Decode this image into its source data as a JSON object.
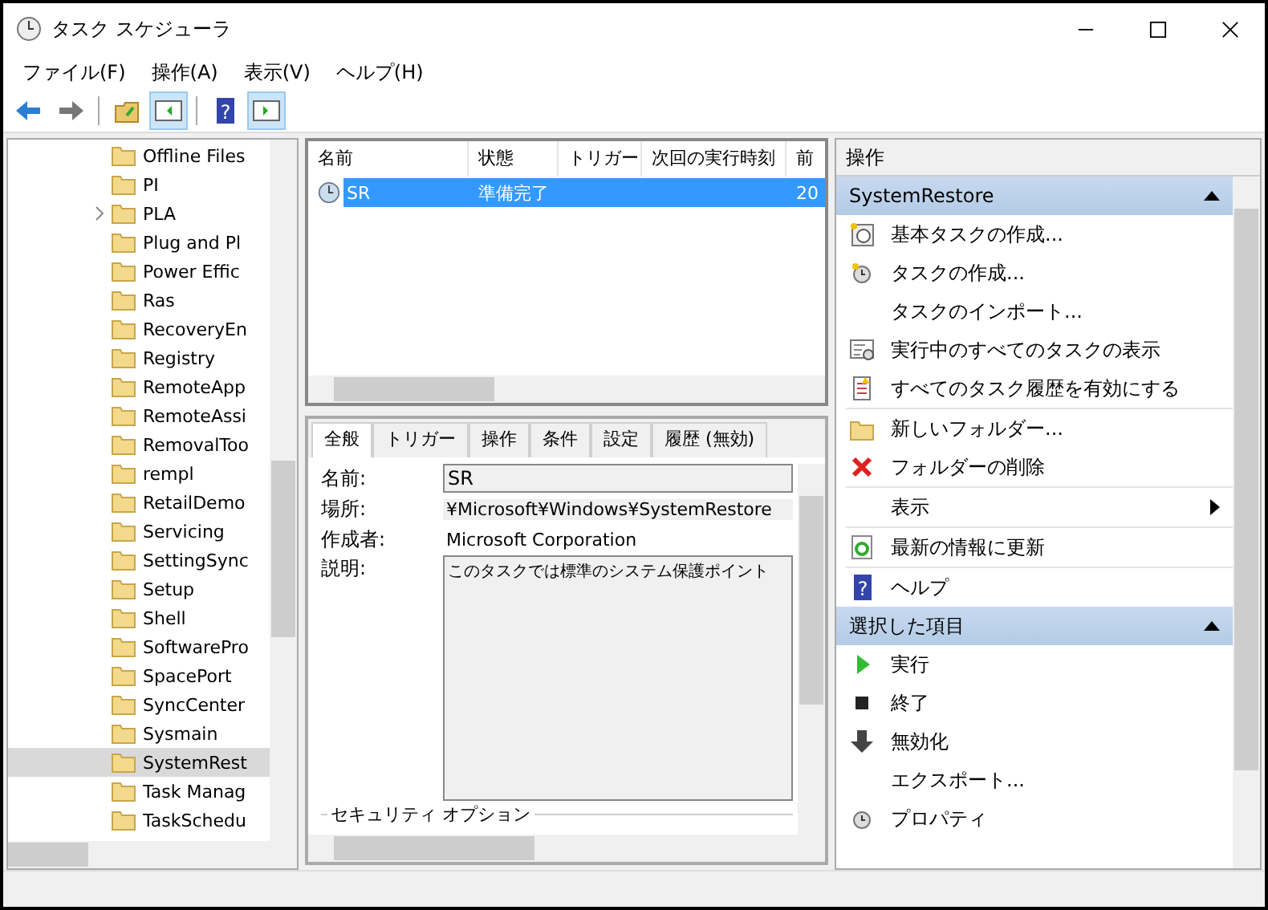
{
  "window": {
    "title": "タスク スケジューラ"
  },
  "menu": [
    "ファイル(F)",
    "操作(A)",
    "表示(V)",
    "ヘルプ(H)"
  ],
  "toolbar": [
    {
      "kind": "back",
      "selected": false
    },
    {
      "kind": "forward",
      "selected": false
    },
    {
      "kind": "sep"
    },
    {
      "kind": "folder-up",
      "selected": false
    },
    {
      "kind": "left-pane",
      "selected": true
    },
    {
      "kind": "sep"
    },
    {
      "kind": "help",
      "selected": false,
      "glyph": "?"
    },
    {
      "kind": "right-pane",
      "selected": true
    }
  ],
  "tree": [
    {
      "label": "Offline Files",
      "selected": false,
      "has_children": false
    },
    {
      "label": "PI",
      "selected": false,
      "has_children": false
    },
    {
      "label": "PLA",
      "selected": false,
      "has_children": true
    },
    {
      "label": "Plug and Pl",
      "selected": false,
      "has_children": false
    },
    {
      "label": "Power Effic",
      "selected": false,
      "has_children": false
    },
    {
      "label": "Ras",
      "selected": false,
      "has_children": false
    },
    {
      "label": "RecoveryEn",
      "selected": false,
      "has_children": false
    },
    {
      "label": "Registry",
      "selected": false,
      "has_children": false
    },
    {
      "label": "RemoteApp",
      "selected": false,
      "has_children": false
    },
    {
      "label": "RemoteAssi",
      "selected": false,
      "has_children": false
    },
    {
      "label": "RemovalToo",
      "selected": false,
      "has_children": false
    },
    {
      "label": "rempl",
      "selected": false,
      "has_children": false
    },
    {
      "label": "RetailDemo",
      "selected": false,
      "has_children": false
    },
    {
      "label": "Servicing",
      "selected": false,
      "has_children": false
    },
    {
      "label": "SettingSync",
      "selected": false,
      "has_children": false
    },
    {
      "label": "Setup",
      "selected": false,
      "has_children": false
    },
    {
      "label": "Shell",
      "selected": false,
      "has_children": false
    },
    {
      "label": "SoftwarePro",
      "selected": false,
      "has_children": false
    },
    {
      "label": "SpacePort",
      "selected": false,
      "has_children": false
    },
    {
      "label": "SyncCenter",
      "selected": false,
      "has_children": false
    },
    {
      "label": "Sysmain",
      "selected": false,
      "has_children": false
    },
    {
      "label": "SystemRest",
      "selected": true,
      "has_children": false
    },
    {
      "label": "Task Manag",
      "selected": false,
      "has_children": false
    },
    {
      "label": "TaskSchedu",
      "selected": false,
      "has_children": false
    }
  ],
  "task_list": {
    "columns": [
      "名前",
      "状態",
      "トリガー",
      "次回の実行時刻",
      "前"
    ],
    "rows": [
      {
        "cells": [
          "SR",
          "準備完了",
          "",
          "",
          "20"
        ],
        "selected": true
      }
    ]
  },
  "detail_tabs": [
    {
      "label": "全般",
      "selected": true
    },
    {
      "label": "トリガー",
      "selected": false
    },
    {
      "label": "操作",
      "selected": false
    },
    {
      "label": "条件",
      "selected": false
    },
    {
      "label": "設定",
      "selected": false
    },
    {
      "label": "履歴 (無効)",
      "selected": false
    }
  ],
  "general": {
    "name_label": "名前:",
    "name_value": "SR",
    "location_label": "場所:",
    "location_value": "¥Microsoft¥Windows¥SystemRestore",
    "author_label": "作成者:",
    "author_value": "Microsoft Corporation",
    "description_label": "説明:",
    "description_value": "このタスクでは標準のシステム保護ポイント",
    "security_group": "セキュリティ オプション"
  },
  "actions_pane": {
    "title": "操作",
    "groups": [
      {
        "title": "SystemRestore",
        "expanded": true,
        "items": [
          {
            "label": "基本タスクの作成...",
            "kind": "basic-task",
            "separator": false,
            "submenu": false
          },
          {
            "label": "タスクの作成...",
            "kind": "create-task",
            "separator": false,
            "submenu": false
          },
          {
            "label": "タスクのインポート...",
            "kind": "none",
            "separator": false,
            "submenu": false
          },
          {
            "label": "実行中のすべてのタスクの表示",
            "kind": "running",
            "separator": false,
            "submenu": false
          },
          {
            "label": "すべてのタスク履歴を有効にする",
            "kind": "history",
            "separator": false,
            "submenu": false
          },
          {
            "label": "新しいフォルダー...",
            "kind": "new-folder",
            "separator": true,
            "submenu": false
          },
          {
            "label": "フォルダーの削除",
            "kind": "delete",
            "separator": false,
            "submenu": false
          },
          {
            "label": "表示",
            "kind": "none",
            "separator": true,
            "submenu": true
          },
          {
            "label": "最新の情報に更新",
            "kind": "refresh",
            "separator": true,
            "submenu": false
          },
          {
            "label": "ヘルプ",
            "kind": "help",
            "separator": true,
            "submenu": false,
            "glyph": "?"
          }
        ]
      },
      {
        "title": "選択した項目",
        "expanded": true,
        "items": [
          {
            "label": "実行",
            "kind": "run",
            "separator": false,
            "submenu": false
          },
          {
            "label": "終了",
            "kind": "stop",
            "separator": false,
            "submenu": false
          },
          {
            "label": "無効化",
            "kind": "disable",
            "separator": false,
            "submenu": false
          },
          {
            "label": "エクスポート...",
            "kind": "none",
            "separator": false,
            "submenu": false
          },
          {
            "label": "プロパティ",
            "kind": "properties",
            "separator": false,
            "submenu": false
          }
        ]
      }
    ]
  }
}
